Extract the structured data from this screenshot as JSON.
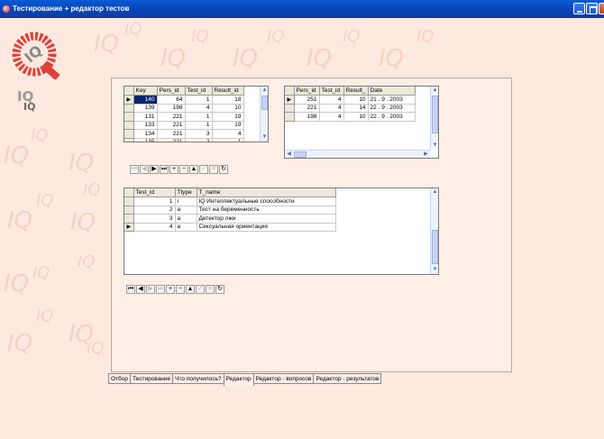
{
  "window": {
    "title": "Тестирование + редактор тестов"
  },
  "watermark": {
    "text": "IQ"
  },
  "results_grid": {
    "columns": [
      "Key",
      "Pers_id",
      "Test_id",
      "Result_id"
    ],
    "rows": [
      [
        "140",
        "64",
        "1",
        "18"
      ],
      [
        "139",
        "198",
        "4",
        "10"
      ],
      [
        "131",
        "221",
        "1",
        "19"
      ],
      [
        "133",
        "221",
        "1",
        "19"
      ],
      [
        "134",
        "221",
        "3",
        "4"
      ],
      [
        "135",
        "221",
        "2",
        "1"
      ]
    ]
  },
  "persons_grid": {
    "columns": [
      "Pers_id",
      "Test_id",
      "Result_",
      "Date"
    ],
    "rows": [
      [
        "251",
        "4",
        "10",
        "21 . 9 . 2003"
      ],
      [
        "221",
        "4",
        "14",
        "22 . 9 . 2003"
      ],
      [
        "198",
        "4",
        "10",
        "22 . 9 . 2003"
      ]
    ]
  },
  "tests_grid": {
    "columns": [
      "Test_id",
      "Ttype",
      "T_name"
    ],
    "rows": [
      [
        "1",
        "i",
        "IQ Интеллектуальные способности"
      ],
      [
        "2",
        "a",
        "Тест на беременность"
      ],
      [
        "3",
        "a",
        "Детектор лжи"
      ],
      [
        "4",
        "a",
        "Сексуальная ориентация"
      ]
    ]
  },
  "navigator": {
    "first": "⏮",
    "prior": "◀",
    "next": "▶",
    "last": "⏭",
    "insert": "+",
    "delete": "−",
    "edit": "▲",
    "post": "✓",
    "cancel": "✕",
    "refresh": "↻"
  },
  "tabs": [
    "Отбор",
    "Тестирование",
    "Что получилось?",
    "Редактор",
    "Редактор - вопросов",
    "Редактор - результатов"
  ],
  "active_tab": "Редактор",
  "colors": {
    "title_bar": "#0a46b8",
    "background": "#fde9df",
    "selection": "#0a246a"
  }
}
